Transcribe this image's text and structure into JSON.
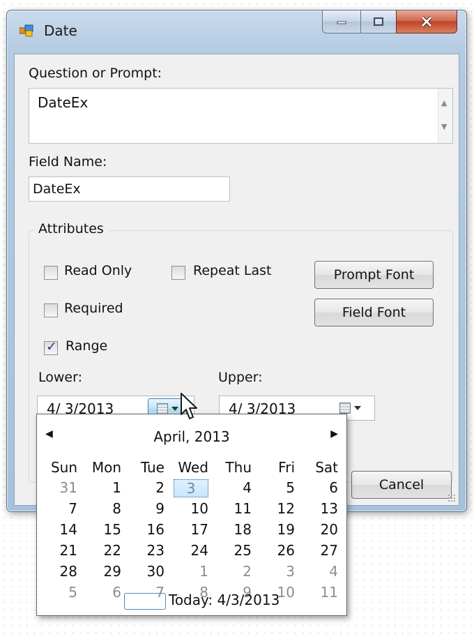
{
  "window": {
    "title": "Date",
    "minimize_icon": "minimize-icon",
    "maximize_icon": "maximize-icon",
    "close_icon": "close-icon"
  },
  "prompt": {
    "label": "Question or Prompt:",
    "value": "DateEx"
  },
  "field": {
    "label": "Field Name:",
    "value": "DateEx"
  },
  "attributes": {
    "title": "Attributes",
    "read_only": {
      "label": "Read Only",
      "checked": false
    },
    "repeat_last": {
      "label": "Repeat Last",
      "checked": false
    },
    "required": {
      "label": "Required",
      "checked": false
    },
    "range": {
      "label": "Range",
      "checked": true,
      "mark": "✓"
    },
    "prompt_font_label": "Prompt Font",
    "field_font_label": "Field Font",
    "lower": {
      "label": "Lower:",
      "value": "4/ 3/2013"
    },
    "upper": {
      "label": "Upper:",
      "value": "4/ 3/2013"
    }
  },
  "buttons": {
    "cancel": "Cancel"
  },
  "calendar": {
    "prev": "◀",
    "next": "▶",
    "month": "April, 2013",
    "weekdays": [
      "Sun",
      "Mon",
      "Tue",
      "Wed",
      "Thu",
      "Fri",
      "Sat"
    ],
    "weeks": [
      [
        "31",
        "1",
        "2",
        "3",
        "4",
        "5",
        "6"
      ],
      [
        "7",
        "8",
        "9",
        "10",
        "11",
        "12",
        "13"
      ],
      [
        "14",
        "15",
        "16",
        "17",
        "18",
        "19",
        "20"
      ],
      [
        "21",
        "22",
        "23",
        "24",
        "25",
        "26",
        "27"
      ],
      [
        "28",
        "29",
        "30",
        "1",
        "2",
        "3",
        "4"
      ],
      [
        "5",
        "6",
        "7",
        "8",
        "9",
        "10",
        "11"
      ]
    ],
    "selected": "3",
    "today_label": "Today: 4/3/2013"
  },
  "colors": {
    "title_bar": "#b9cfe6",
    "close_button": "#c7462b",
    "selection": "#c9e6fb"
  }
}
